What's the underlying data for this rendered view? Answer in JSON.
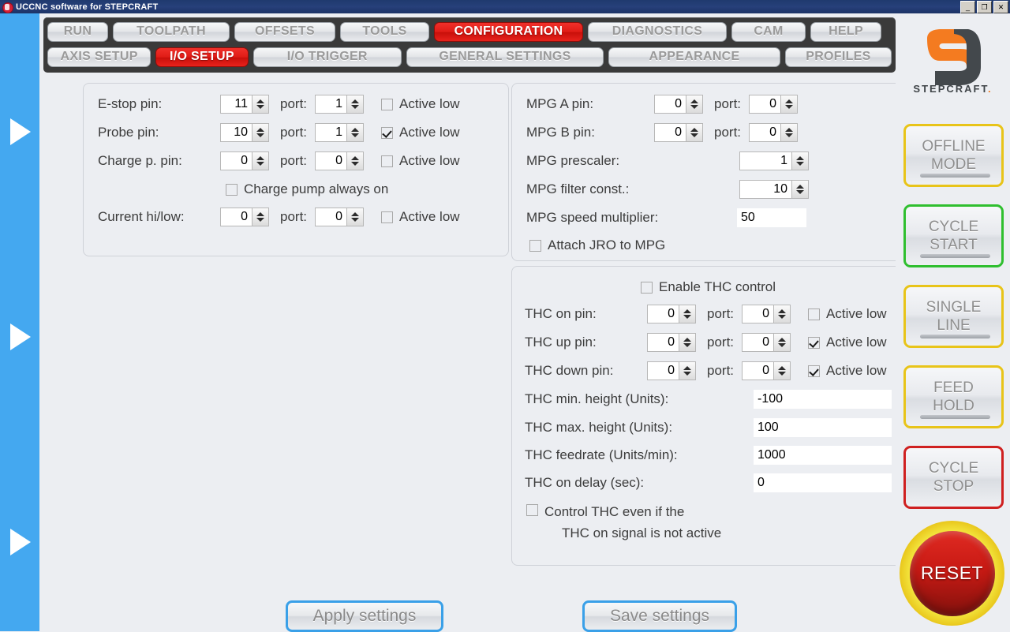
{
  "window": {
    "title": "UCCNC software for STEPCRAFT",
    "icon": "app-logo-icon",
    "minimize": "_",
    "restore": "❐",
    "close": "✕"
  },
  "tabs": {
    "primary": [
      {
        "label": "RUN",
        "active": false
      },
      {
        "label": "TOOLPATH",
        "active": false
      },
      {
        "label": "OFFSETS",
        "active": false
      },
      {
        "label": "TOOLS",
        "active": false
      },
      {
        "label": "CONFIGURATION",
        "active": true
      },
      {
        "label": "DIAGNOSTICS",
        "active": false
      },
      {
        "label": "CAM",
        "active": false
      },
      {
        "label": "HELP",
        "active": false
      }
    ],
    "secondary": [
      {
        "label": "AXIS SETUP",
        "active": false
      },
      {
        "label": "I/O SETUP",
        "active": true
      },
      {
        "label": "I/O  TRIGGER",
        "active": false
      },
      {
        "label": "GENERAL SETTINGS",
        "active": false
      },
      {
        "label": "APPEARANCE",
        "active": false
      },
      {
        "label": "PROFILES",
        "active": false
      }
    ]
  },
  "io_panel": {
    "estop": {
      "label": "E-stop pin:",
      "pin": "11",
      "port_label": "port:",
      "port": "1",
      "active_low_label": "Active low",
      "active_low": false
    },
    "probe": {
      "label": "Probe pin:",
      "pin": "10",
      "port_label": "port:",
      "port": "1",
      "active_low_label": "Active low",
      "active_low": true
    },
    "charge_pump": {
      "label": "Charge p. pin:",
      "pin": "0",
      "port_label": "port:",
      "port": "0",
      "active_low_label": "Active low",
      "active_low": false
    },
    "charge_pump_always_on": {
      "label": "Charge pump always on",
      "checked": false
    },
    "current_hilow": {
      "label": "Current hi/low:",
      "pin": "0",
      "port_label": "port:",
      "port": "0",
      "active_low_label": "Active low",
      "active_low": false
    }
  },
  "mpg_panel": {
    "a_pin": {
      "label": "MPG A pin:",
      "pin": "0",
      "port_label": "port:",
      "port": "0"
    },
    "b_pin": {
      "label": "MPG B pin:",
      "pin": "0",
      "port_label": "port:",
      "port": "0"
    },
    "prescaler": {
      "label": "MPG prescaler:",
      "value": "1"
    },
    "filter_const": {
      "label": "MPG filter const.:",
      "value": "10"
    },
    "speed_multiplier": {
      "label": "MPG speed multiplier:",
      "value": "50"
    },
    "attach_jro": {
      "label": "Attach JRO to MPG",
      "checked": false
    }
  },
  "thc_panel": {
    "enable": {
      "label": "Enable THC control",
      "checked": false
    },
    "on_pin": {
      "label": "THC on pin:",
      "pin": "0",
      "port_label": "port:",
      "port": "0",
      "active_low_label": "Active low",
      "active_low": false
    },
    "up_pin": {
      "label": "THC up pin:",
      "pin": "0",
      "port_label": "port:",
      "port": "0",
      "active_low_label": "Active low",
      "active_low": true
    },
    "down_pin": {
      "label": "THC down pin:",
      "pin": "0",
      "port_label": "port:",
      "port": "0",
      "active_low_label": "Active low",
      "active_low": true
    },
    "min_height": {
      "label": "THC min. height (Units):",
      "value": "-100"
    },
    "max_height": {
      "label": "THC max. height (Units):",
      "value": "100"
    },
    "feedrate": {
      "label": "THC feedrate (Units/min):",
      "value": "1000"
    },
    "on_delay": {
      "label": "THC on delay (sec):",
      "value": "0"
    },
    "control_even": {
      "line1": "Control THC even if the",
      "line2": "THC on signal is not active",
      "checked": false
    }
  },
  "actions": {
    "apply": "Apply settings",
    "save": "Save settings"
  },
  "sidebar": {
    "brand": "STEPCRAFT",
    "brand_dot": ".",
    "buttons": [
      {
        "line1": "OFFLINE",
        "line2": "MODE",
        "accent": "#e8c419",
        "has_bar": true
      },
      {
        "line1": "CYCLE",
        "line2": "START",
        "accent": "#2fbf2f",
        "has_bar": true
      },
      {
        "line1": "SINGLE",
        "line2": "LINE",
        "accent": "#e8c419",
        "has_bar": true
      },
      {
        "line1": "FEED",
        "line2": "HOLD",
        "accent": "#e8c419",
        "has_bar": true
      },
      {
        "line1": "CYCLE",
        "line2": "STOP",
        "accent": "#cf2020",
        "has_bar": false
      }
    ],
    "reset": "RESET"
  },
  "rail": {
    "arrows": [
      "play-arrow-1",
      "play-arrow-2",
      "play-arrow-3"
    ]
  },
  "colors": {
    "accent_blue": "#44a8f0",
    "active_tab_red": "#e01c16",
    "brand_orange": "#f47b20",
    "panel_bg": "#eceef2",
    "tabstrip_bg": "#3a3a3a"
  }
}
